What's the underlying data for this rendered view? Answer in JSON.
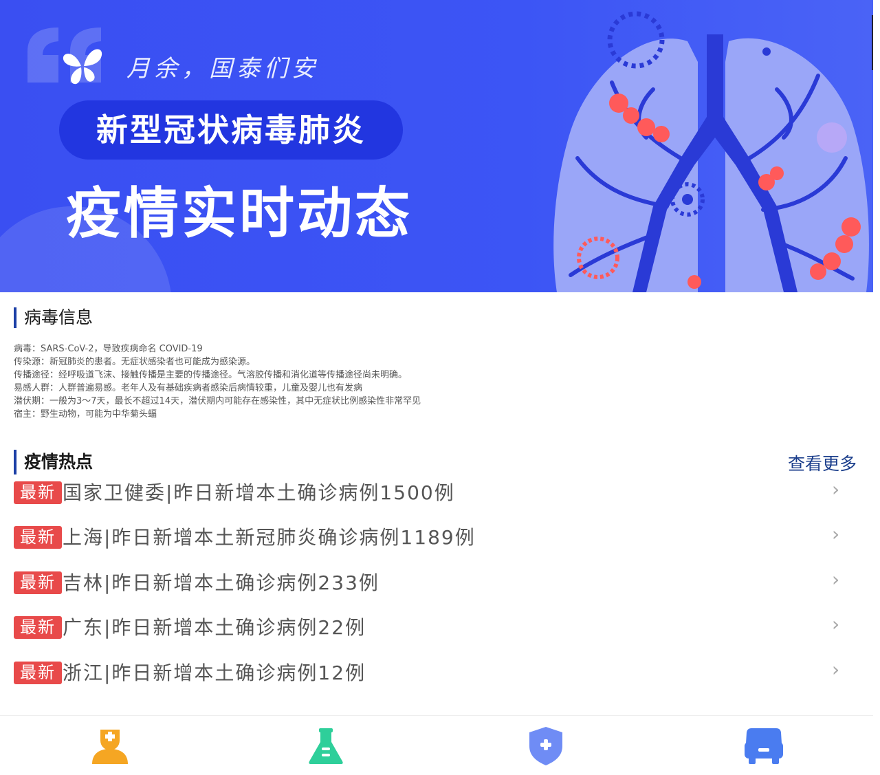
{
  "banner": {
    "slogan": "月余，国泰们安",
    "pill_title": "新型冠状病毒肺炎",
    "headline": "疫情实时动态"
  },
  "virus_section": {
    "title": "病毒信息",
    "lines": [
      "病毒：SARS-CoV-2，导致疾病命名 COVID-19",
      "传染源：新冠肺炎的患者。无症状感染者也可能成为感染源。",
      "传播途径：经呼吸道飞沫、接触传播是主要的传播途径。气溶胶传播和消化道等传播途径尚未明确。",
      "易感人群：人群普遍易感。老年人及有基础疾病者感染后病情较重，儿童及婴儿也有发病",
      "潜伏期：一般为3～7天，最长不超过14天，潜伏期内可能存在感染性，其中无症状比例感染性非常罕见",
      "宿主：野生动物，可能为中华菊头蝠"
    ]
  },
  "hot_section": {
    "title": "疫情热点",
    "more_label": "查看更多",
    "tag_label": "最新",
    "items": [
      "国家卫健委|昨日新增本土确诊病例1500例",
      "上海|昨日新增本土新冠肺炎确诊病例1189例",
      "吉林|昨日新增本土确诊病例233例",
      "广东|昨日新增本土确诊病例22例",
      "浙江|昨日新增本土确诊病例12例"
    ]
  },
  "tabbar": {
    "tabs": [
      {
        "icon": "doctor-icon",
        "color": "#f5a623"
      },
      {
        "icon": "flask-icon",
        "color": "#2ecf9a"
      },
      {
        "icon": "shield-plus-icon",
        "color": "#6f8cf5"
      },
      {
        "icon": "car-icon",
        "color": "#4a7cf0"
      }
    ]
  },
  "colors": {
    "banner_bg": "#3a4ff2",
    "accent_bar": "#1c3fa6",
    "tag_red": "#e84a4a",
    "link_blue": "#1c3f8c"
  }
}
